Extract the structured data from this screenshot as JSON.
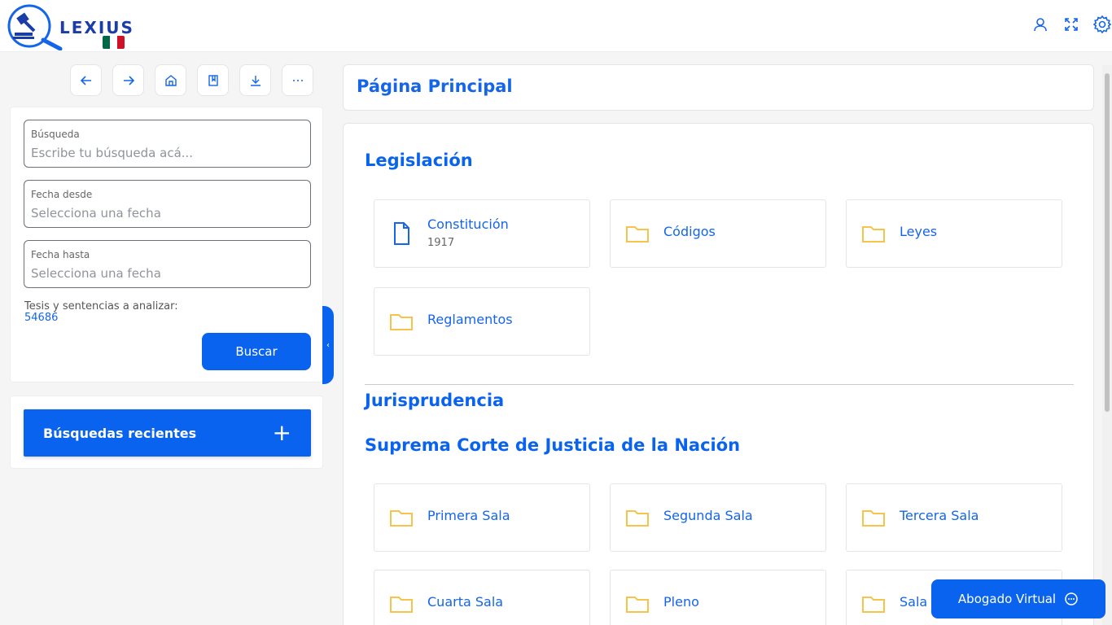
{
  "header": {
    "logo_text": "LEXIUS",
    "flag_colors": [
      "#006847",
      "#ffffff",
      "#ce1126"
    ],
    "icons": [
      "user-icon",
      "fullscreen-icon",
      "gear-icon"
    ]
  },
  "toolbar": {
    "buttons": [
      "back-arrow-icon",
      "forward-arrow-icon",
      "home-icon",
      "bookmark-icon",
      "download-icon",
      "more-icon"
    ]
  },
  "search": {
    "query": {
      "label": "Búsqueda",
      "placeholder": "Escribe tu búsqueda acá..."
    },
    "date_from": {
      "label": "Fecha desde",
      "placeholder": "Selecciona una fecha"
    },
    "date_to": {
      "label": "Fecha hasta",
      "placeholder": "Selecciona una fecha"
    },
    "analyze_label": "Tesis y sentencias a analizar:",
    "analyze_count": "54686",
    "button": "Buscar"
  },
  "recent": {
    "label": "Búsquedas recientes",
    "plus": "+"
  },
  "main": {
    "title": "Página Principal",
    "legislacion": {
      "heading": "Legislación",
      "items": [
        {
          "label": "Constitución",
          "sub": "1917",
          "icon": "document-icon"
        },
        {
          "label": "Códigos",
          "icon": "folder-icon"
        },
        {
          "label": "Leyes",
          "icon": "folder-icon"
        },
        {
          "label": "Reglamentos",
          "icon": "folder-icon"
        }
      ]
    },
    "jurisprudencia": {
      "heading": "Jurisprudencia"
    },
    "scjn": {
      "heading": "Suprema Corte de Justicia de la Nación",
      "items": [
        {
          "label": "Primera Sala"
        },
        {
          "label": "Segunda Sala"
        },
        {
          "label": "Tercera Sala"
        },
        {
          "label": "Cuarta Sala"
        },
        {
          "label": "Pleno"
        },
        {
          "label": "Sala"
        }
      ]
    }
  },
  "chat": {
    "label": "Abogado Virtual",
    "icon": "chat-icon"
  },
  "colors": {
    "primary": "#0a63ee",
    "folder": "#f7c34a"
  }
}
